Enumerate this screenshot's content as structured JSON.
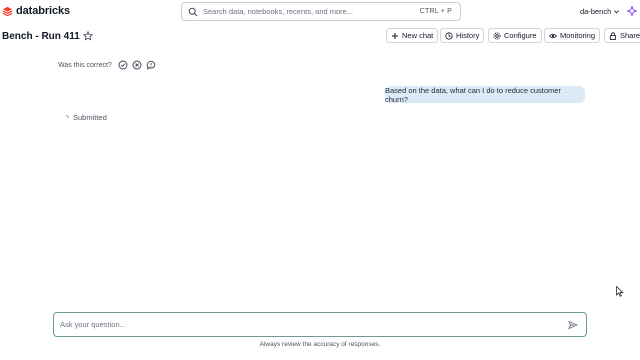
{
  "app": {
    "name": "databricks"
  },
  "search": {
    "placeholder": "Search data, notebooks, recents, and more...",
    "shortcut": "CTRL + P"
  },
  "workspace": {
    "name": "da-bench"
  },
  "page": {
    "title": "Bench - Run 411"
  },
  "toolbar": {
    "new_chat": "New chat",
    "history": "History",
    "configure": "Configure",
    "monitoring": "Monitoring",
    "share": "Share"
  },
  "feedback": {
    "question": "Was this correct?"
  },
  "conversation": {
    "user_message": "Based on the data, what can I do to reduce customer churn?",
    "status": "Submitted"
  },
  "composer": {
    "placeholder": "Ask your question...",
    "disclaimer": "Always review the accuracy of responses."
  },
  "colors": {
    "brand": "#ff3621",
    "bubble": "#dce9f6",
    "input_border": "#6b9b96"
  }
}
